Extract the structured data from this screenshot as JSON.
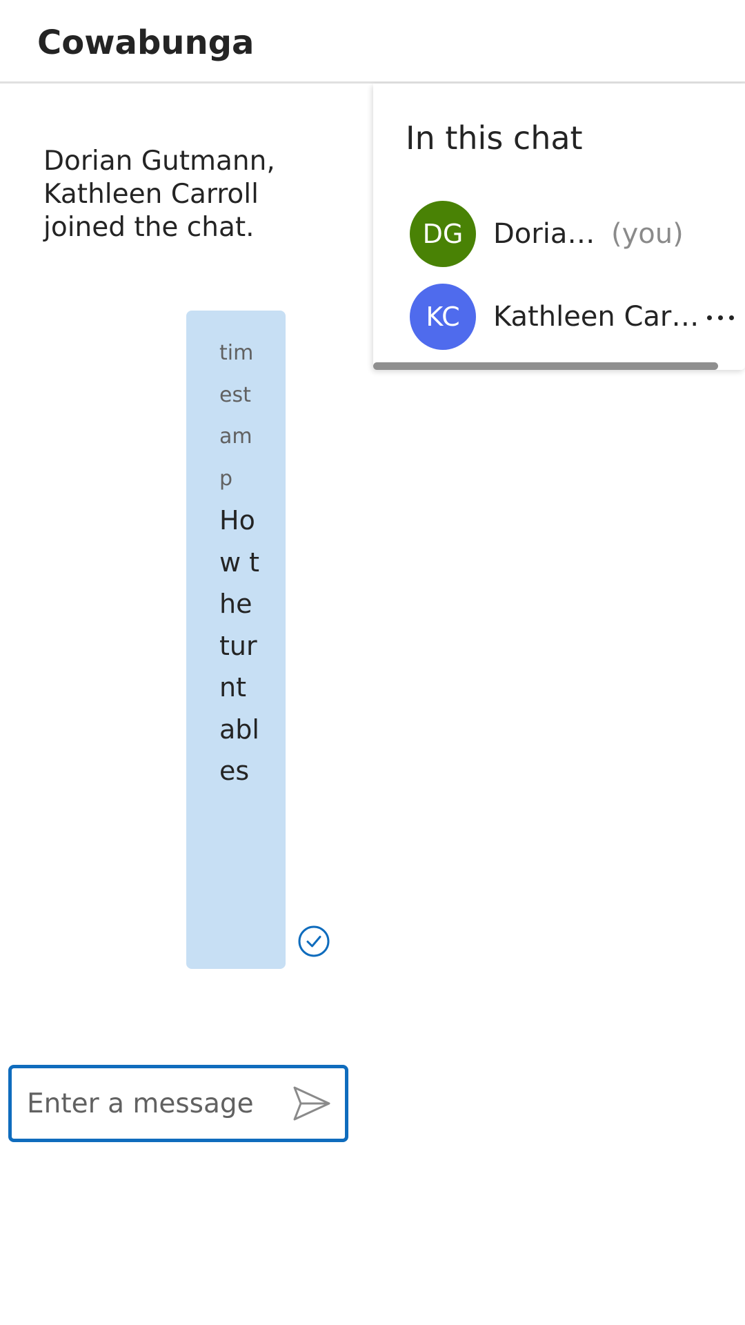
{
  "header": {
    "title": "Cowabunga"
  },
  "system_message": {
    "text": "Dorian Gutmann, Kathleen Carroll joined the chat."
  },
  "message": {
    "timestamp": "timestamp",
    "text": "How the turntables",
    "status_icon": "read-check-icon",
    "bubble_color": "#c7dff4"
  },
  "composer": {
    "placeholder": "Enter a message",
    "value": "",
    "send_icon": "send-icon",
    "accent_color": "#0f6cbd"
  },
  "participants_panel": {
    "title": "In this chat",
    "participants": [
      {
        "initials": "DG",
        "name": "Doria…",
        "tag": "(you)",
        "avatar_color": "#498205"
      },
      {
        "initials": "KC",
        "name": "Kathleen Car…",
        "more_icon": "more-options-icon",
        "avatar_color": "#4f6bed"
      }
    ]
  }
}
